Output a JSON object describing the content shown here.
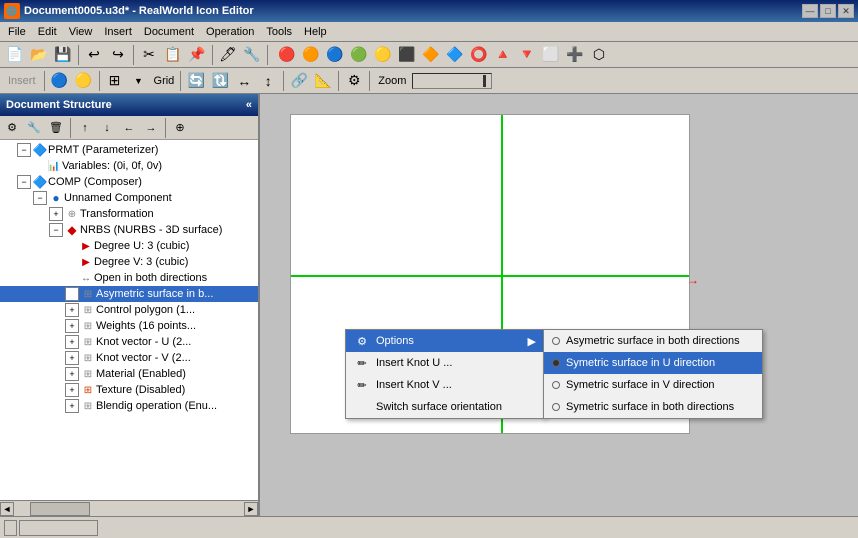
{
  "window": {
    "title": "Document0005.u3d* - RealWorld Icon Editor",
    "icon": "🎨"
  },
  "titlebar": {
    "minimize": "—",
    "maximize": "□",
    "close": "✕"
  },
  "menu": {
    "items": [
      "File",
      "Edit",
      "View",
      "Insert",
      "Document",
      "Operation",
      "Tools",
      "Help"
    ]
  },
  "left_panel": {
    "title": "Document Structure",
    "collapse_icon": "«"
  },
  "tree": {
    "items": [
      {
        "id": "prmt",
        "label": "PRMT (Parameterizer)",
        "indent": 0,
        "expanded": true,
        "icon": "🔷",
        "hasExpander": true
      },
      {
        "id": "vars",
        "label": "Variables: (0i, 0f, 0v)",
        "indent": 1,
        "expanded": false,
        "icon": "📊",
        "hasExpander": false
      },
      {
        "id": "comp",
        "label": "COMP (Composer)",
        "indent": 1,
        "expanded": true,
        "icon": "🔷",
        "hasExpander": true
      },
      {
        "id": "unnamed",
        "label": "Unnamed Component",
        "indent": 2,
        "expanded": true,
        "icon": "🔵",
        "hasExpander": true
      },
      {
        "id": "transform",
        "label": "Transformation",
        "indent": 3,
        "expanded": false,
        "icon": "🔧",
        "hasExpander": true
      },
      {
        "id": "nurbs",
        "label": "NRBS (NURBS - 3D surface)",
        "indent": 3,
        "expanded": true,
        "icon": "🔴",
        "hasExpander": true
      },
      {
        "id": "degu",
        "label": "Degree U: 3 (cubic)",
        "indent": 4,
        "expanded": false,
        "icon": "➡️",
        "hasExpander": false
      },
      {
        "id": "degv",
        "label": "Degree V: 3 (cubic)",
        "indent": 4,
        "expanded": false,
        "icon": "➡️",
        "hasExpander": false
      },
      {
        "id": "opendir",
        "label": "Open in both directions",
        "indent": 4,
        "expanded": false,
        "icon": "↕️",
        "hasExpander": false
      },
      {
        "id": "asymsurface",
        "label": "Asymetric surface in b...",
        "indent": 4,
        "expanded": false,
        "icon": "⊞",
        "hasExpander": true,
        "selected": true
      },
      {
        "id": "ctrlpoly",
        "label": "Control polygon (1...",
        "indent": 4,
        "expanded": false,
        "icon": "⊞",
        "hasExpander": true
      },
      {
        "id": "weights",
        "label": "Weights (16 points...",
        "indent": 4,
        "expanded": false,
        "icon": "⊞",
        "hasExpander": true
      },
      {
        "id": "knotvectu",
        "label": "Knot vector - U (2...",
        "indent": 4,
        "expanded": false,
        "icon": "⊞",
        "hasExpander": true
      },
      {
        "id": "knotvectv",
        "label": "Knot vector - V (2...",
        "indent": 4,
        "expanded": false,
        "icon": "⊞",
        "hasExpander": true
      },
      {
        "id": "material",
        "label": "Material (Enabled)",
        "indent": 4,
        "expanded": false,
        "icon": "⊞",
        "hasExpander": true
      },
      {
        "id": "texture",
        "label": "Texture (Disabled)",
        "indent": 4,
        "expanded": false,
        "icon": "⊞",
        "hasExpander": true
      },
      {
        "id": "blending",
        "label": "Blendig operation (Enu...",
        "indent": 4,
        "expanded": false,
        "icon": "⊞",
        "hasExpander": true
      }
    ]
  },
  "context_menu": {
    "header": "Options",
    "header_icon": "⚙️",
    "items": [
      {
        "id": "insert-knot-u",
        "label": "Insert Knot U ...",
        "icon": "✏️"
      },
      {
        "id": "insert-knot-v",
        "label": "Insert Knot V ...",
        "icon": "✏️"
      },
      {
        "id": "switch-orient",
        "label": "Switch surface orientation",
        "icon": ""
      }
    ],
    "has_submenu": true
  },
  "submenu": {
    "items": [
      {
        "id": "asym-both",
        "label": "Asymetric surface in both directions",
        "radio": true,
        "selected": false
      },
      {
        "id": "sym-u",
        "label": "Symetric surface in U direction",
        "radio": false,
        "selected": true
      },
      {
        "id": "sym-v",
        "label": "Symetric surface in V direction",
        "radio": false,
        "selected": false
      },
      {
        "id": "sym-both",
        "label": "Symetric surface in both directions",
        "radio": false,
        "selected": false
      }
    ]
  },
  "toolbar2": {
    "insert_label": "Insert",
    "zoom_label": "Zoom"
  }
}
